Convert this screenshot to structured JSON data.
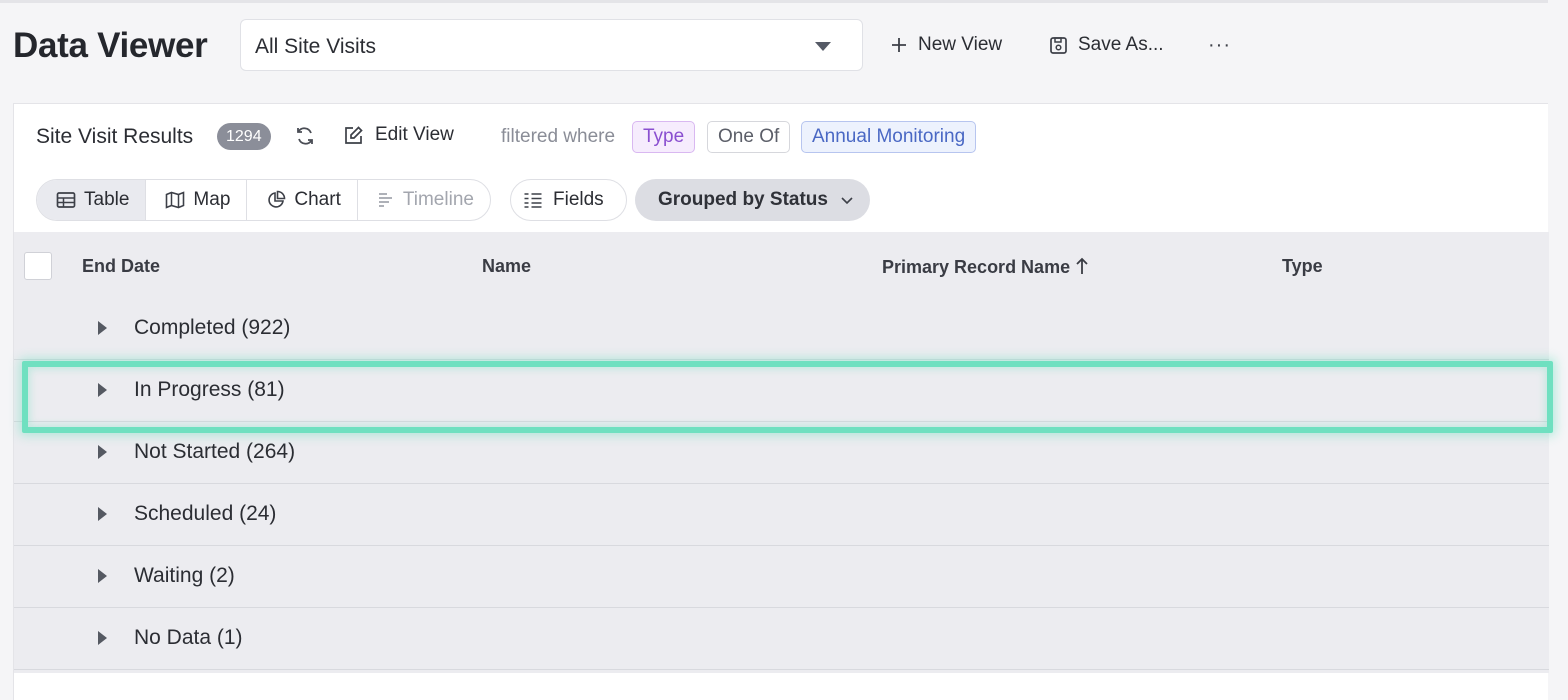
{
  "header": {
    "title": "Data Viewer",
    "view_select": "All Site Visits",
    "new_view": "New View",
    "save_as": "Save As...",
    "more": "···"
  },
  "results": {
    "title": "Site Visit Results",
    "count": "1294",
    "edit_view": "Edit View",
    "filter_prefix": "filtered where",
    "filter_field": "Type",
    "filter_operator": "One Of",
    "filter_value": "Annual Monitoring"
  },
  "toolbar": {
    "views": [
      {
        "label": "Table",
        "icon": "table-icon",
        "state": "active"
      },
      {
        "label": "Map",
        "icon": "map-icon",
        "state": "normal"
      },
      {
        "label": "Chart",
        "icon": "pie-chart-icon",
        "state": "normal"
      },
      {
        "label": "Timeline",
        "icon": "timeline-icon",
        "state": "disabled"
      }
    ],
    "fields": "Fields",
    "group_by": "Grouped by Status"
  },
  "table": {
    "columns": [
      "End Date",
      "Name",
      "Primary Record Name",
      "Type"
    ],
    "sorted_column": "Primary Record Name",
    "sort_direction": "ascending",
    "groups": [
      {
        "label": "Completed (922)"
      },
      {
        "label": "In Progress (81)",
        "highlighted": true
      },
      {
        "label": "Not Started (264)"
      },
      {
        "label": "Scheduled (24)"
      },
      {
        "label": "Waiting (2)"
      },
      {
        "label": "No Data (1)"
      }
    ]
  },
  "colors": {
    "highlight": "#6fe0c0",
    "chip_type": "#8a4fd0",
    "chip_value": "#4a68c4",
    "count_badge": "#8b8e99"
  }
}
